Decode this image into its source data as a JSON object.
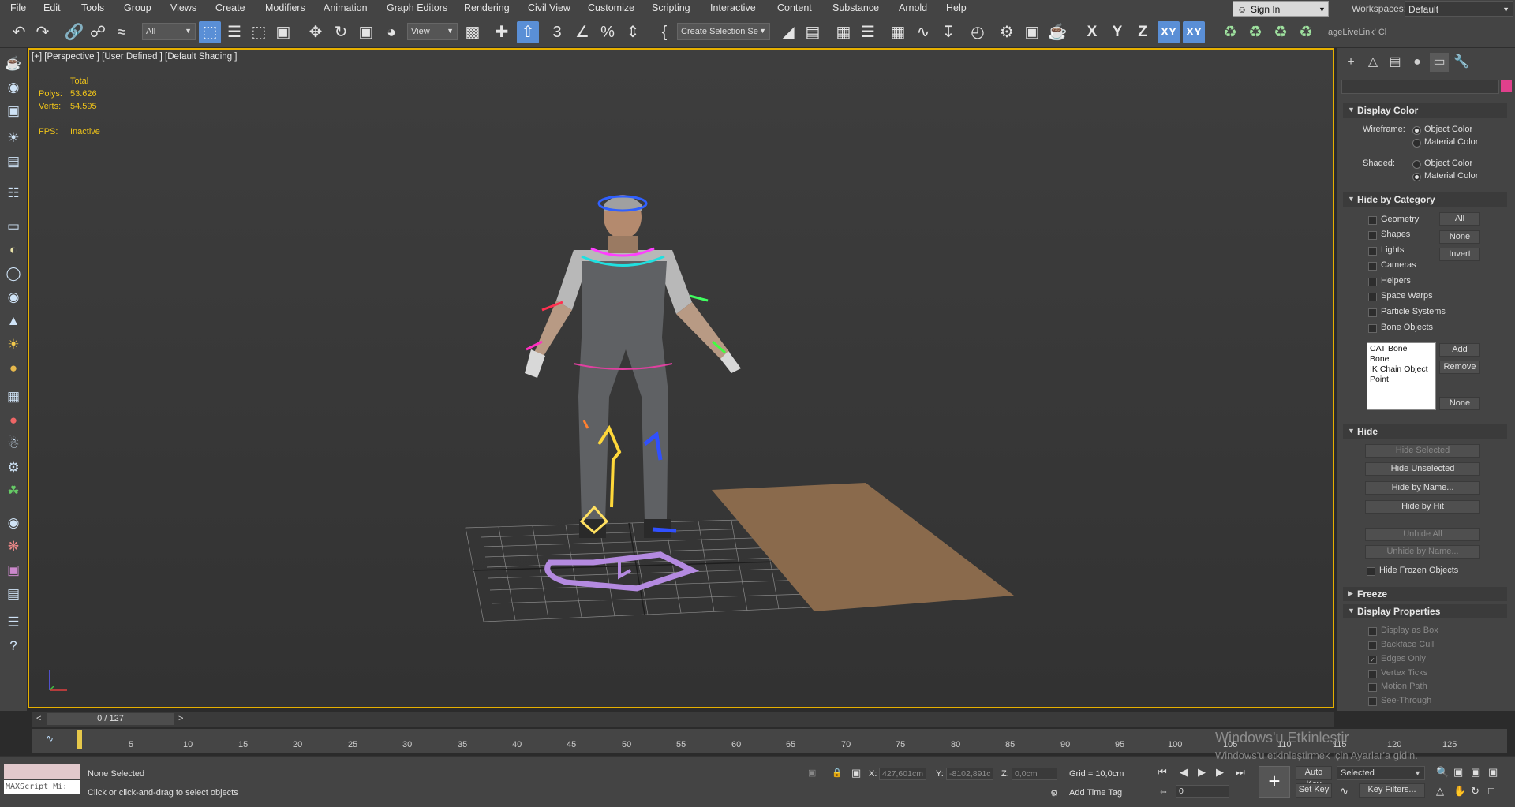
{
  "menu": [
    "File",
    "Edit",
    "Tools",
    "Group",
    "Views",
    "Create",
    "Modifiers",
    "Animation",
    "Graph Editors",
    "Rendering",
    "Civil View",
    "Customize",
    "Scripting",
    "Interactive",
    "Content",
    "Substance",
    "Arnold",
    "Help"
  ],
  "account": {
    "sign_in": "Sign In",
    "workspaces_label": "Workspaces:",
    "workspace": "Default"
  },
  "toolbar": {
    "filter": "All",
    "ref_coord": "View",
    "selection_set": "Create Selection Se",
    "axes": [
      "X",
      "Y",
      "Z",
      "XY",
      "XY"
    ],
    "livelink": "ageLiveLink' Cl"
  },
  "viewport": {
    "label": "[+] [Perspective ] [User Defined ] [Default Shading ]",
    "stats_header": "Total",
    "polys_label": "Polys:",
    "polys": "53.626",
    "verts_label": "Verts:",
    "verts": "54.595",
    "fps_label": "FPS:",
    "fps": "Inactive"
  },
  "command_panel": {
    "display_color": {
      "title": "Display Color",
      "wireframe_label": "Wireframe:",
      "shaded_label": "Shaded:",
      "object_color": "Object Color",
      "material_color": "Material Color",
      "wireframe_choice": "Object Color",
      "shaded_choice": "Material Color"
    },
    "hide_by_category": {
      "title": "Hide by Category",
      "items": [
        "Geometry",
        "Shapes",
        "Lights",
        "Cameras",
        "Helpers",
        "Space Warps",
        "Particle Systems",
        "Bone Objects"
      ],
      "all": "All",
      "none": "None",
      "invert": "Invert",
      "list": [
        "CAT Bone",
        "Bone",
        "IK Chain Object",
        "Point"
      ],
      "add": "Add",
      "remove": "Remove",
      "none2": "None"
    },
    "hide": {
      "title": "Hide",
      "hide_selected": "Hide Selected",
      "hide_unselected": "Hide Unselected",
      "hide_by_name": "Hide by Name...",
      "hide_by_hit": "Hide by Hit",
      "unhide_all": "Unhide All",
      "unhide_by_name": "Unhide by Name...",
      "hide_frozen": "Hide Frozen Objects"
    },
    "freeze": {
      "title": "Freeze"
    },
    "display_properties": {
      "title": "Display Properties",
      "items": [
        "Display as Box",
        "Backface Cull",
        "Edges Only",
        "Vertex Ticks",
        "Motion Path",
        "See-Through"
      ],
      "checked": "Edges Only"
    }
  },
  "timeline": {
    "frame": "0 / 127",
    "ticks": [
      "5",
      "10",
      "15",
      "20",
      "25",
      "30",
      "35",
      "40",
      "45",
      "50",
      "55",
      "60",
      "65",
      "70",
      "75",
      "80",
      "85",
      "90",
      "95",
      "100",
      "105",
      "110",
      "115",
      "120",
      "125"
    ]
  },
  "status": {
    "maxscript": "MAXScript Mi:",
    "selection": "None Selected",
    "prompt": "Click or click-and-drag to select objects",
    "x_label": "X:",
    "x": "427,601cm",
    "y_label": "Y:",
    "y": "-8102,891c",
    "z_label": "Z:",
    "z": "0,0cm",
    "grid": "Grid = 10,0cm",
    "add_time_tag": "Add Time Tag",
    "auto_key": "Auto Key",
    "set_key": "Set Key",
    "key_mode": "Selected",
    "key_filters": "Key Filters...",
    "current_frame": "0"
  },
  "windows": {
    "title": "Windows'u Etkinleştir",
    "subtitle": "Windows'u etkinleştirmek için Ayarlar'a gidin."
  }
}
